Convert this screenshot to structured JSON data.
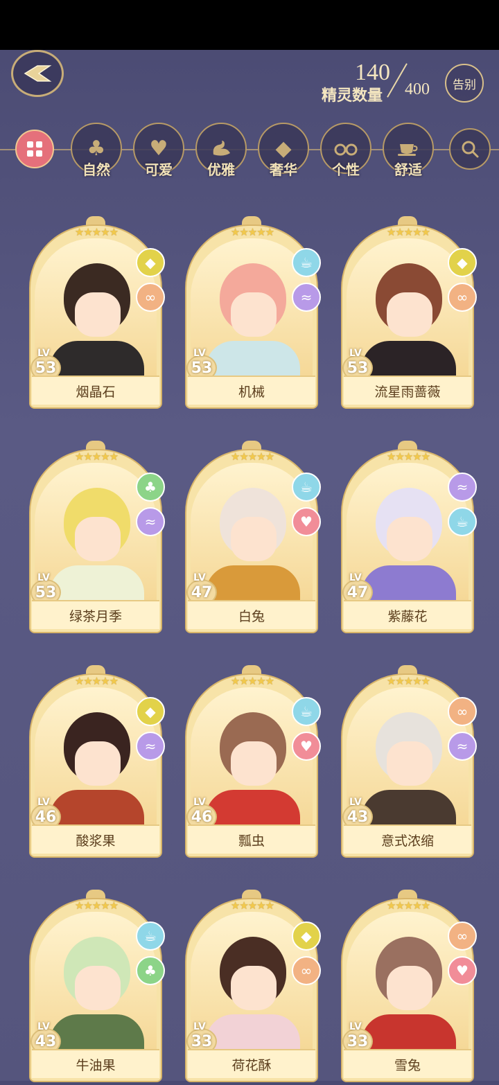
{
  "header": {
    "count_label": "精灵数量",
    "count_current": "140",
    "count_max": "400",
    "farewell_label": "告别"
  },
  "filters": [
    {
      "key": "all",
      "label": "",
      "icon": "grid-icon"
    },
    {
      "key": "nature",
      "label": "自然",
      "icon": "clover-icon"
    },
    {
      "key": "cute",
      "label": "可爱",
      "icon": "heart-icon"
    },
    {
      "key": "elegant",
      "label": "优雅",
      "icon": "swan-icon"
    },
    {
      "key": "luxury",
      "label": "奢华",
      "icon": "diamond-icon"
    },
    {
      "key": "personality",
      "label": "个性",
      "icon": "glasses-icon"
    },
    {
      "key": "comfort",
      "label": "舒适",
      "icon": "teacup-icon"
    }
  ],
  "lv_label": "LV",
  "cards": [
    {
      "name": "烟晶石",
      "level": "53",
      "stars": 5,
      "tags": [
        "luxury",
        "personality"
      ],
      "hair": "#3b2a22",
      "outfit": "#2e2b2b"
    },
    {
      "name": "机械",
      "level": "53",
      "stars": 5,
      "tags": [
        "comfort",
        "elegant"
      ],
      "hair": "#f4a99b",
      "outfit": "#cde6e8"
    },
    {
      "name": "流星雨蔷薇",
      "level": "53",
      "stars": 5,
      "tags": [
        "luxury",
        "personality"
      ],
      "hair": "#8a4a34",
      "outfit": "#2b2326"
    },
    {
      "name": "绿茶月季",
      "level": "53",
      "stars": 5,
      "tags": [
        "nature",
        "elegant"
      ],
      "hair": "#f0dc6a",
      "outfit": "#eef2d6"
    },
    {
      "name": "白兔",
      "level": "47",
      "stars": 5,
      "tags": [
        "comfort",
        "cute"
      ],
      "hair": "#efe3da",
      "outfit": "#d99a3a"
    },
    {
      "name": "紫藤花",
      "level": "47",
      "stars": 5,
      "tags": [
        "elegant",
        "comfort"
      ],
      "hair": "#e6e1f3",
      "outfit": "#8d7bd0"
    },
    {
      "name": "酸浆果",
      "level": "46",
      "stars": 5,
      "tags": [
        "luxury",
        "elegant"
      ],
      "hair": "#3a2420",
      "outfit": "#b5452c"
    },
    {
      "name": "瓢虫",
      "level": "46",
      "stars": 5,
      "tags": [
        "comfort",
        "cute"
      ],
      "hair": "#9a6a52",
      "outfit": "#d33a32"
    },
    {
      "name": "意式浓缩",
      "level": "43",
      "stars": 5,
      "tags": [
        "personality",
        "elegant"
      ],
      "hair": "#e7e2dc",
      "outfit": "#4a3a30"
    },
    {
      "name": "牛油果",
      "level": "43",
      "stars": 5,
      "tags": [
        "comfort",
        "nature"
      ],
      "hair": "#cfe7b7",
      "outfit": "#5e7a4a"
    },
    {
      "name": "荷花酥",
      "level": "33",
      "stars": 5,
      "tags": [
        "luxury",
        "personality"
      ],
      "hair": "#4a2e24",
      "outfit": "#f2d2d6"
    },
    {
      "name": "雪兔",
      "level": "33",
      "stars": 5,
      "tags": [
        "personality",
        "cute"
      ],
      "hair": "#9a7060",
      "outfit": "#c8352e"
    }
  ]
}
